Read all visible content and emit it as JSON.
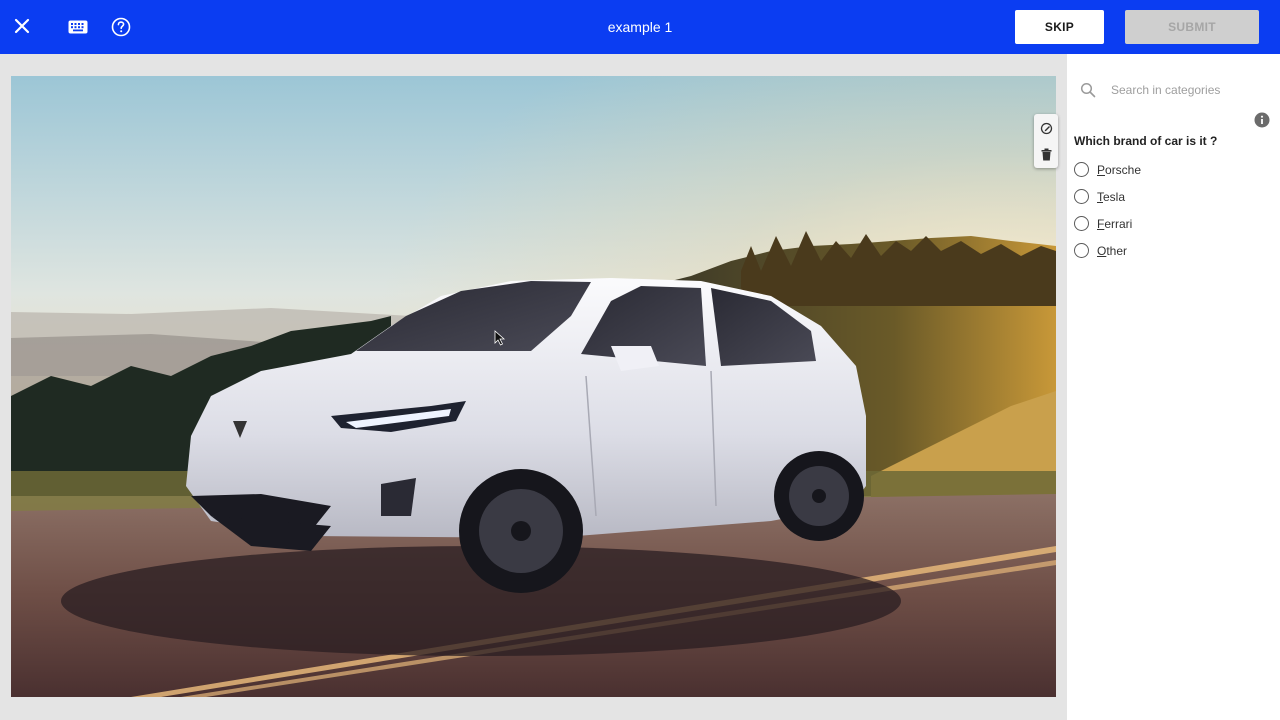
{
  "header": {
    "title": "example 1",
    "skip_label": "SKIP",
    "submit_label": "SUBMIT",
    "close_icon": "close-icon",
    "keyboard_icon": "keyboard-icon",
    "help_icon": "help-circle-icon",
    "bar_color": "#0b3df2"
  },
  "image": {
    "subject": "white electric SUV on a road at sunset"
  },
  "image_tools": [
    {
      "icon": "edit-icon"
    },
    {
      "icon": "trash-icon"
    }
  ],
  "panel": {
    "search_placeholder": "Search in categories",
    "info_icon": "info-icon",
    "question": "Which brand of car is it ?",
    "options": [
      {
        "label": "Porsche",
        "selected": false
      },
      {
        "label": "Tesla",
        "selected": false
      },
      {
        "label": "Ferrari",
        "selected": false
      },
      {
        "label": "Other",
        "selected": false
      }
    ]
  }
}
